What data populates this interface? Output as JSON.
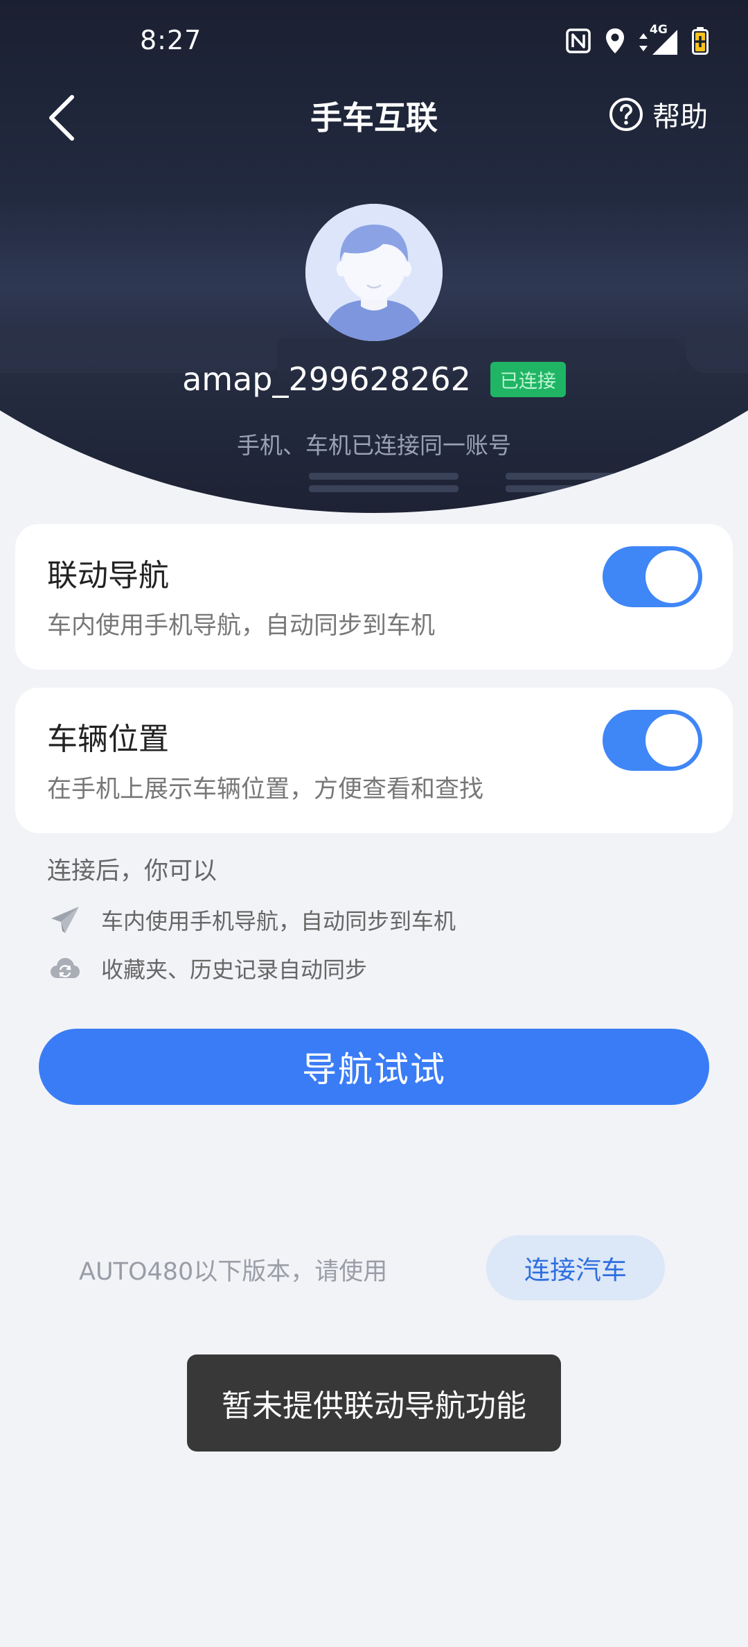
{
  "status_bar": {
    "time": "8:27",
    "network": "4G",
    "icons": [
      "nfc-icon",
      "location-icon",
      "data-arrows-icon",
      "signal-icon",
      "battery-icon"
    ]
  },
  "header": {
    "title": "手车互联",
    "help_label": "帮助",
    "icons": [
      "back-arrow-icon",
      "help-circle-icon"
    ]
  },
  "profile": {
    "username": "amap_299628262",
    "status_badge": "已连接",
    "account_hint": "手机、车机已连接同一账号"
  },
  "settings": [
    {
      "title": "联动导航",
      "description": "车内使用手机导航，自动同步到车机",
      "enabled": true
    },
    {
      "title": "车辆位置",
      "description": "在手机上展示车辆位置，方便查看和查找",
      "enabled": true
    }
  ],
  "features": {
    "heading": "连接后，你可以",
    "items": [
      {
        "icon": "paper-plane-icon",
        "text": "车内使用手机导航，自动同步到车机"
      },
      {
        "icon": "cloud-sync-icon",
        "text": "收藏夹、历史记录自动同步"
      }
    ]
  },
  "primary_button": "导航试试",
  "legacy": {
    "text": "AUTO480以下版本，请使用",
    "button": "连接汽车"
  },
  "toast": "暂未提供联动导航功能",
  "colors": {
    "accent": "#3a7cf6",
    "connected": "#1fb564",
    "header_dark": "#1b2031",
    "toast_bg": "#383838"
  }
}
